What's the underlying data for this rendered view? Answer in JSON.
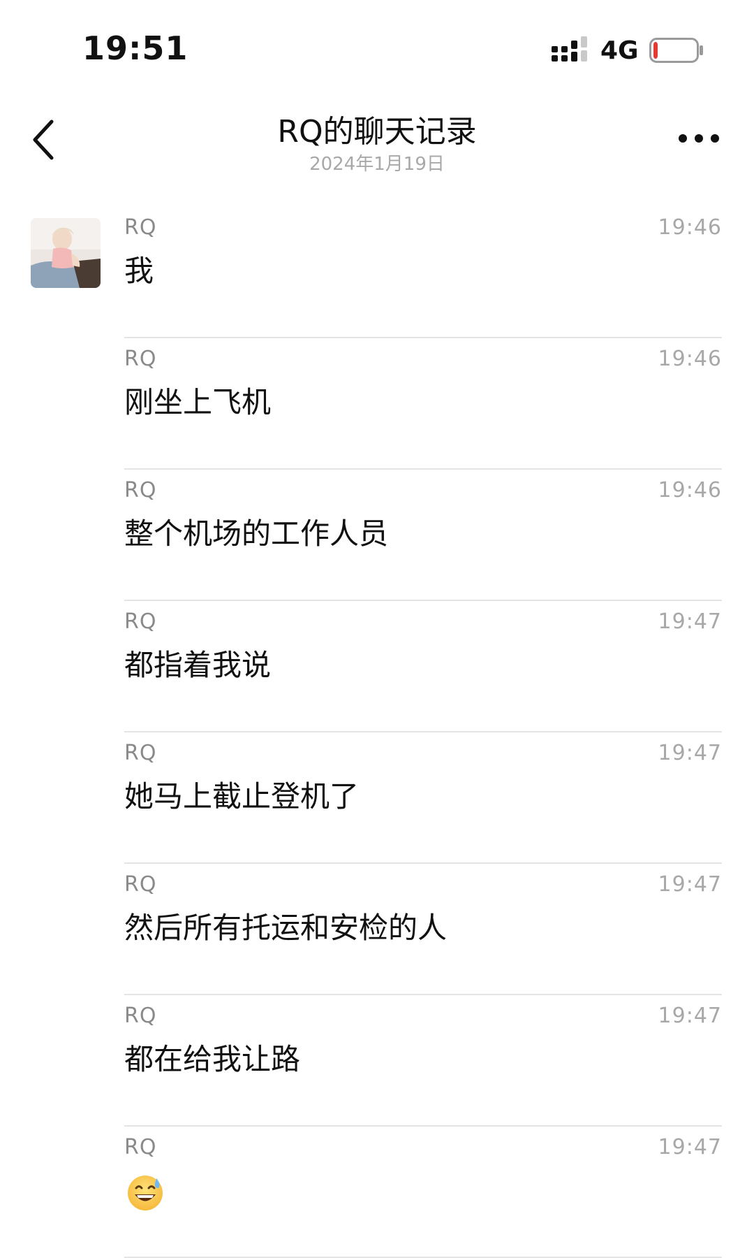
{
  "status_bar": {
    "time": "19:51",
    "network": "4G",
    "signal_icon": "signal-bars-icon",
    "battery_icon": "battery-low-icon",
    "battery_level": 0.1,
    "battery_color": "#e53935"
  },
  "header": {
    "title": "RQ的聊天记录",
    "subtitle": "2024年1月19日",
    "back_icon": "chevron-left-icon",
    "more_icon": "more-dots-icon"
  },
  "messages": [
    {
      "sender": "RQ",
      "time": "19:46",
      "text": "我"
    },
    {
      "sender": "RQ",
      "time": "19:46",
      "text": "刚坐上飞机"
    },
    {
      "sender": "RQ",
      "time": "19:46",
      "text": "整个机场的工作人员"
    },
    {
      "sender": "RQ",
      "time": "19:47",
      "text": "都指着我说"
    },
    {
      "sender": "RQ",
      "time": "19:47",
      "text": "她马上截止登机了"
    },
    {
      "sender": "RQ",
      "time": "19:47",
      "text": "然后所有托运和安检的人"
    },
    {
      "sender": "RQ",
      "time": "19:47",
      "text": "都在给我让路"
    },
    {
      "sender": "RQ",
      "time": "19:47",
      "text": "",
      "emoji": "grinning-sweat-emoji"
    }
  ],
  "colors": {
    "text_primary": "#111111",
    "text_secondary": "#8a8a8a",
    "text_muted": "#a8a8a8",
    "divider": "#e4e4e4"
  }
}
